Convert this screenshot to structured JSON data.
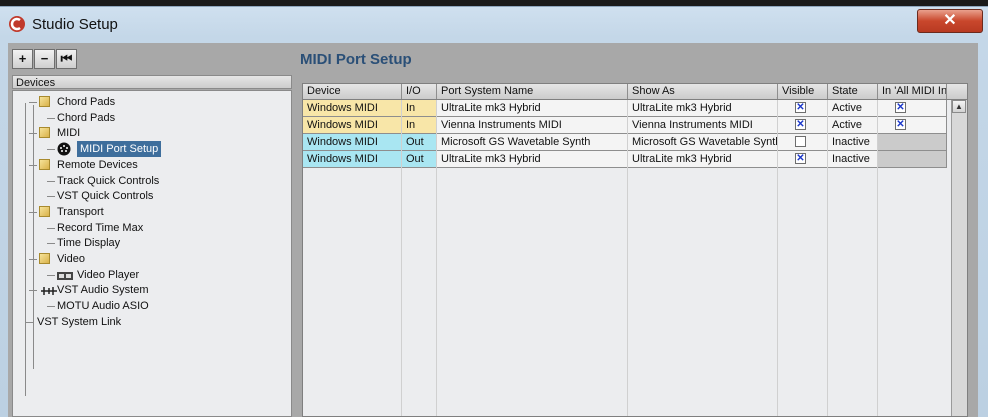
{
  "window": {
    "title": "Studio Setup",
    "close_label": "✕"
  },
  "toolbar": {
    "add_label": "+",
    "remove_label": "−",
    "reset_label": "⏮"
  },
  "devices": {
    "header": "Devices",
    "items": [
      {
        "label": "Chord Pads",
        "level": 1,
        "icon": "folder-icon"
      },
      {
        "label": "Chord Pads",
        "level": 2,
        "icon": ""
      },
      {
        "label": "MIDI",
        "level": 1,
        "icon": "folder-icon"
      },
      {
        "label": "MIDI Port Setup",
        "level": 2,
        "icon": "midi-port-icon",
        "selected": true
      },
      {
        "label": "Remote Devices",
        "level": 1,
        "icon": "folder-icon"
      },
      {
        "label": "Track Quick Controls",
        "level": 2,
        "icon": ""
      },
      {
        "label": "VST Quick Controls",
        "level": 2,
        "icon": ""
      },
      {
        "label": "Transport",
        "level": 1,
        "icon": "folder-icon"
      },
      {
        "label": "Record Time Max",
        "level": 2,
        "icon": ""
      },
      {
        "label": "Time Display",
        "level": 2,
        "icon": ""
      },
      {
        "label": "Video",
        "level": 1,
        "icon": "folder-icon"
      },
      {
        "label": "Video Player",
        "level": 2,
        "icon": "video-icon"
      },
      {
        "label": "VST Audio System",
        "level": 1,
        "icon": "audio-system-icon"
      },
      {
        "label": "MOTU Audio ASIO",
        "level": 2,
        "icon": ""
      },
      {
        "label": "VST System Link",
        "level": 0,
        "icon": ""
      }
    ]
  },
  "midi_port_setup": {
    "title": "MIDI Port Setup",
    "columns": [
      "Device",
      "I/O",
      "Port System Name",
      "Show As",
      "Visible",
      "State",
      "In 'All MIDI Inputs'"
    ],
    "rows": [
      {
        "device": "Windows MIDI",
        "io": "In",
        "port_system_name": "UltraLite mk3 Hybrid",
        "show_as": "UltraLite mk3 Hybrid",
        "visible": true,
        "state": "Active",
        "all_midi": true,
        "color": "#f8e6a8"
      },
      {
        "device": "Windows MIDI",
        "io": "In",
        "port_system_name": "Vienna Instruments MIDI",
        "show_as": "Vienna Instruments MIDI",
        "visible": true,
        "state": "Active",
        "all_midi": true,
        "color": "#f8e6a8"
      },
      {
        "device": "Windows MIDI",
        "io": "Out",
        "port_system_name": "Microsoft GS Wavetable Synth",
        "show_as": "Microsoft GS Wavetable Synth",
        "visible": false,
        "state": "Inactive",
        "all_midi": null,
        "color": "#a9e6f2"
      },
      {
        "device": "Windows MIDI",
        "io": "Out",
        "port_system_name": "UltraLite mk3 Hybrid",
        "show_as": "UltraLite mk3 Hybrid",
        "visible": true,
        "state": "Inactive",
        "all_midi": null,
        "color": "#a9e6f2"
      }
    ]
  }
}
